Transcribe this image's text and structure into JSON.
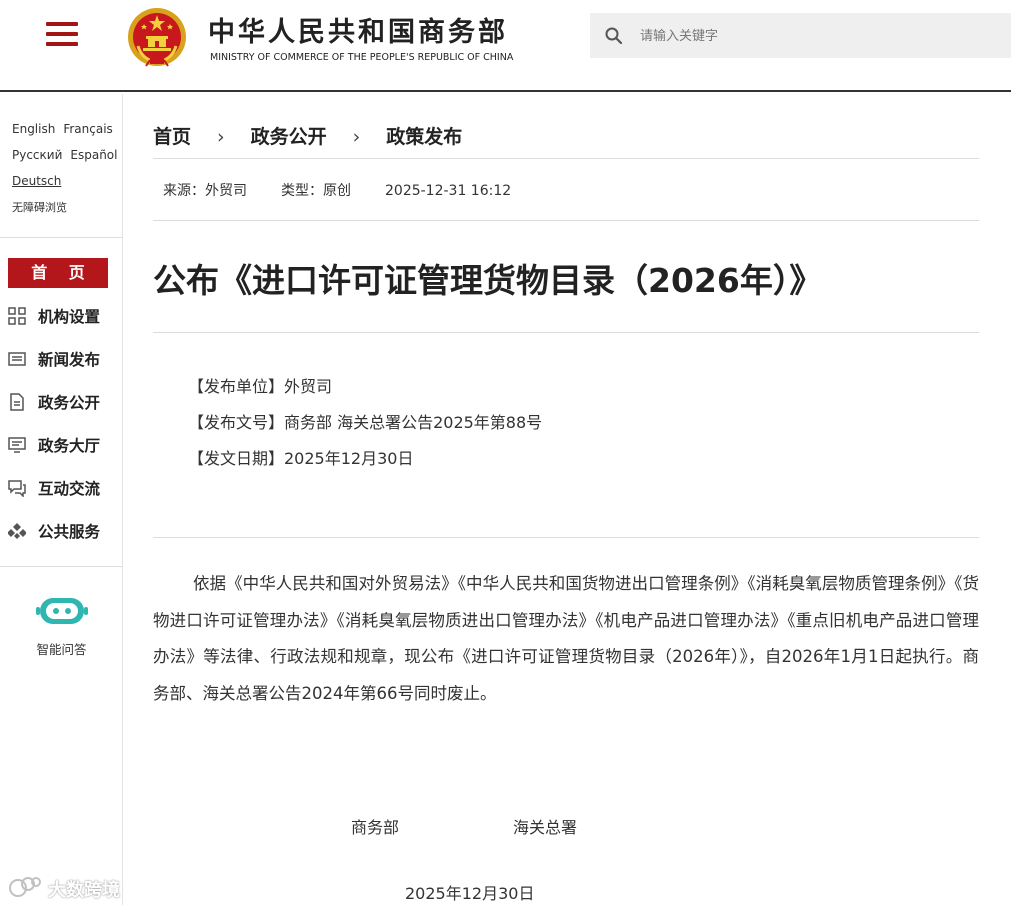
{
  "header": {
    "site_title": "中华人民共和国商务部",
    "site_subtitle": "MINISTRY OF COMMERCE OF THE PEOPLE'S REPUBLIC OF CHINA",
    "search_placeholder": "请输入关键字",
    "brand_color": "#a31515"
  },
  "sidebar": {
    "languages": [
      "English",
      "Français",
      "Русский",
      "Español",
      "Deutsch"
    ],
    "accessibility": "无障碍浏览",
    "home_label": "首 页",
    "items": [
      {
        "label": "机构设置",
        "icon": "grid-icon"
      },
      {
        "label": "新闻发布",
        "icon": "newspaper-icon"
      },
      {
        "label": "政务公开",
        "icon": "document-icon"
      },
      {
        "label": "政务大厅",
        "icon": "hall-icon"
      },
      {
        "label": "互动交流",
        "icon": "chat-icon"
      },
      {
        "label": "公共服务",
        "icon": "service-icon"
      }
    ],
    "assistant_label": "智能问答",
    "watermark": "大数跨境"
  },
  "breadcrumb": [
    "首页",
    "政务公开",
    "政策发布"
  ],
  "meta": {
    "source": "来源：外贸司",
    "type": "类型：原创",
    "datetime": "2025-12-31 16:12"
  },
  "article": {
    "title": "公布《进口许可证管理货物目录（2026年）》",
    "issuer": "【发布单位】外贸司",
    "doc_number": "【发布文号】商务部 海关总署公告2025年第88号",
    "issue_date": "【发文日期】2025年12月30日",
    "body": "依据《中华人民共和国对外贸易法》《中华人民共和国货物进出口管理条例》《消耗臭氧层物质管理条例》《货物进口许可证管理办法》《消耗臭氧层物质进出口管理办法》《机电产品进口管理办法》《重点旧机电产品进口管理办法》等法律、行政法规和规章，现公布《进口许可证管理货物目录（2026年）》，自2026年1月1日起执行。商务部、海关总署公告2024年第66号同时废止。",
    "signatory_1": "商务部",
    "signatory_2": "海关总署",
    "sign_date": "2025年12月30日"
  }
}
